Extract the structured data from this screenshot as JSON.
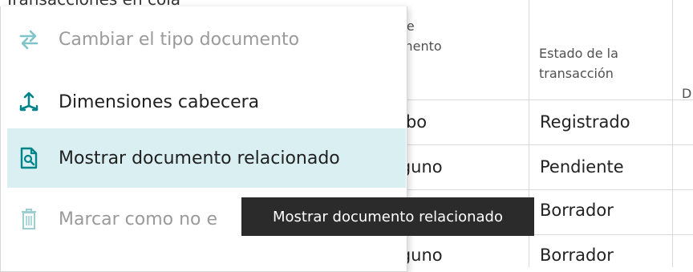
{
  "page_header": "Transacciones en cola",
  "table": {
    "headers": [
      {
        "name": "tipo-documento-header",
        "text": "Tipo de\nDocumento\nreceo"
      },
      {
        "name": "estado-transaccion-header",
        "text": "Estado de la\ntransacción"
      },
      {
        "name": "next-column-header",
        "text": "D"
      }
    ],
    "rows": [
      {
        "tipo": "Recibo",
        "estado": "Registrado"
      },
      {
        "tipo": "Ninguno",
        "estado": "Pendiente"
      },
      {
        "tipo": "",
        "estado": "Borrador"
      },
      {
        "tipo": "Ninguno",
        "estado": "Borrador"
      }
    ]
  },
  "menu": {
    "items": [
      {
        "label": "Cambiar el tipo documento",
        "icon": "swap-arrows-icon",
        "disabled": true
      },
      {
        "label": "Dimensiones cabecera",
        "icon": "dimensions-icon",
        "disabled": false
      },
      {
        "label": "Mostrar documento relacionado",
        "icon": "related-document-icon",
        "disabled": false,
        "hover": true
      },
      {
        "label": "Marcar como no e",
        "icon": "trash-icon",
        "disabled": true
      }
    ]
  },
  "tooltip": {
    "text": "Mostrar documento relacionado"
  },
  "colors": {
    "accent": "#008489",
    "hover_bg": "#d9eff2",
    "disabled_text": "#9a9a9a",
    "tooltip_bg": "#2b2b2b"
  }
}
